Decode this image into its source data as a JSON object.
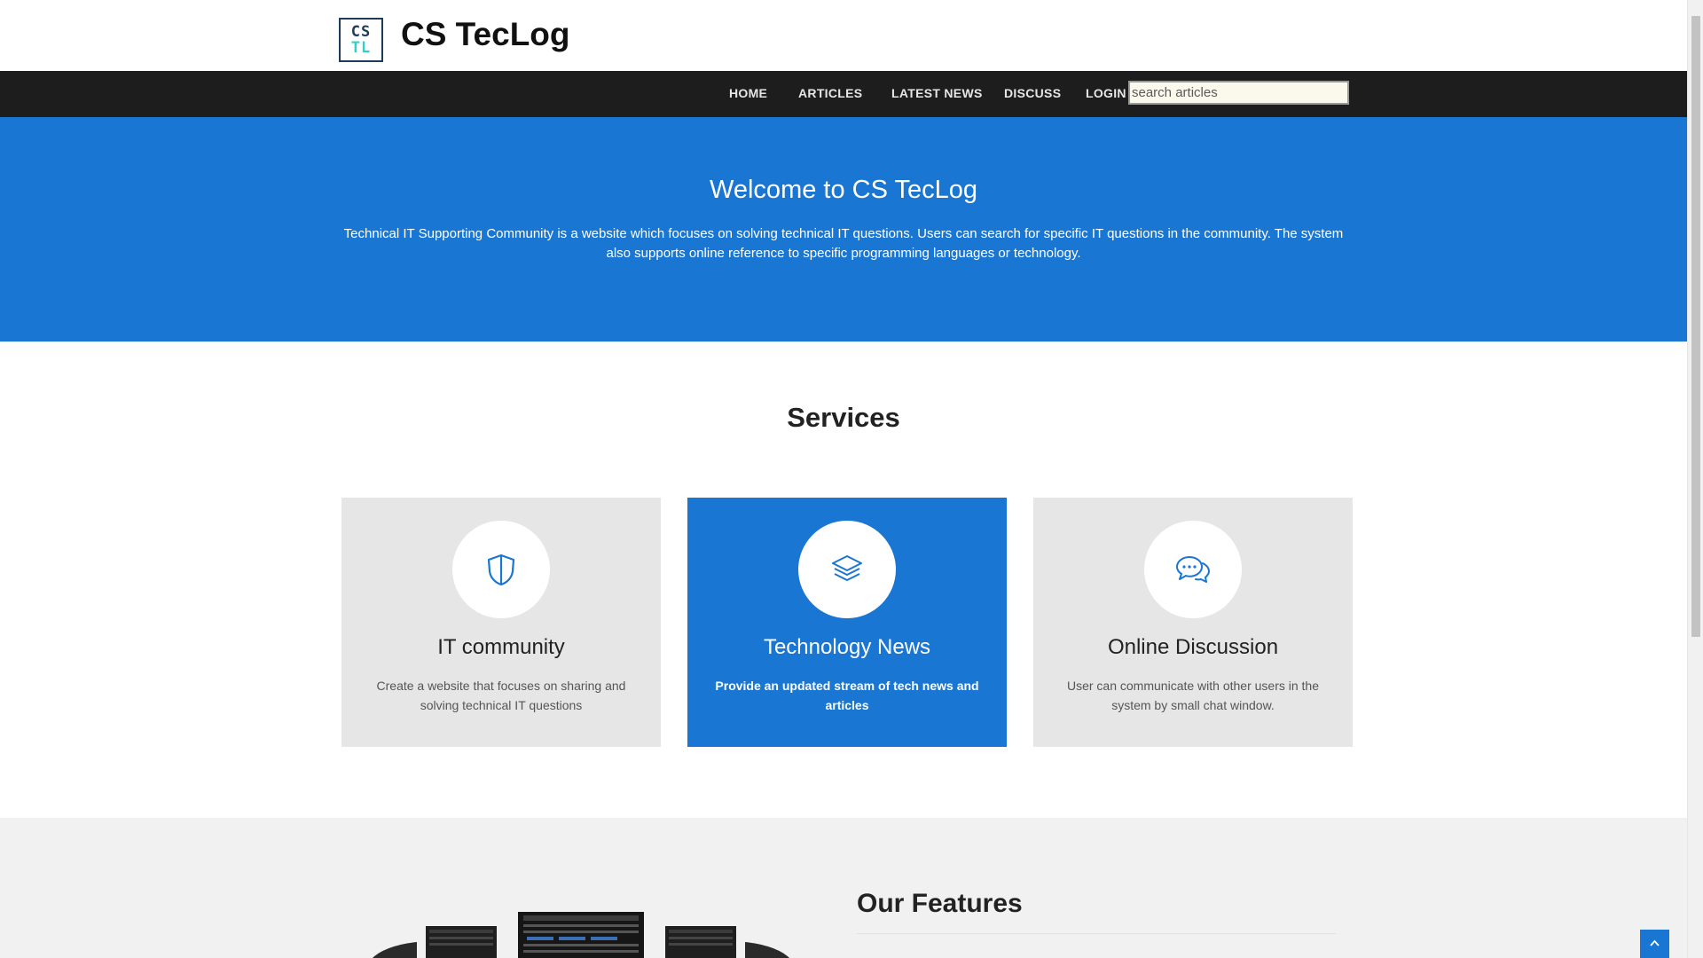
{
  "brand": {
    "logo_line1": "CS",
    "logo_line2": "TL",
    "title": "CS TecLog"
  },
  "nav": {
    "items": [
      "HOME",
      "ARTICLES",
      "LATEST NEWS",
      "DISCUSS",
      "LOGIN"
    ],
    "search_placeholder": "search articles"
  },
  "hero": {
    "title": "Welcome to CS TecLog",
    "text": "Technical IT Supporting Community is a website which focuses on solving technical IT questions. Users can search for specific IT questions in the community. The system also supports online reference to specific programming languages or technology."
  },
  "services": {
    "title": "Services",
    "cards": [
      {
        "icon": "shield-icon",
        "title": "IT community",
        "text": "Create a website that focuses on sharing and solving technical IT questions",
        "active": false
      },
      {
        "icon": "layers-icon",
        "title": "Technology News",
        "text": "Provide an updated stream of tech news and articles",
        "active": true
      },
      {
        "icon": "chat-bubbles-icon",
        "title": "Online Discussion",
        "text": "User can communicate with other users in the system by small chat window.",
        "active": false
      }
    ]
  },
  "features": {
    "title": "Our Features",
    "image": "server-racks-image"
  },
  "colors": {
    "primary": "#1976d2",
    "nav_bg": "#1d1d1d",
    "card_bg": "#e6e6e6",
    "features_bg": "#f1f1f1",
    "logo_accent": "#2bd4c4"
  }
}
